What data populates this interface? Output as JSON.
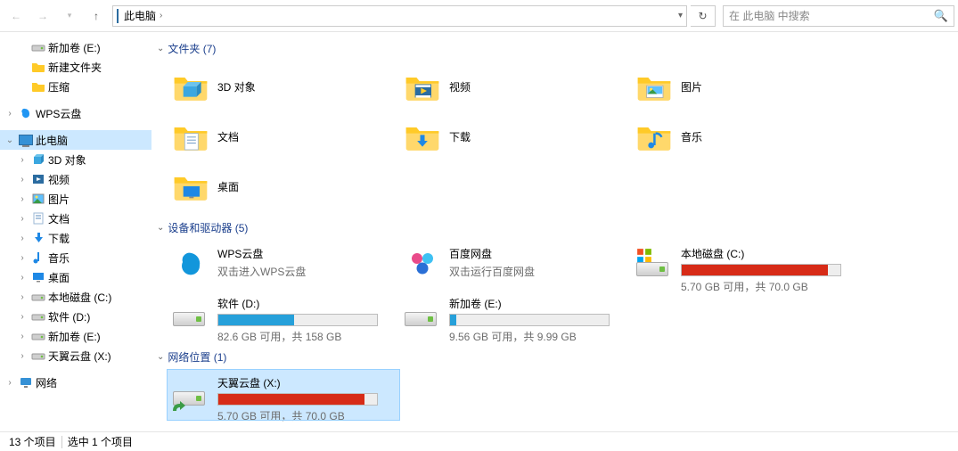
{
  "address": {
    "location": "此电脑",
    "refresh": "↻"
  },
  "search": {
    "placeholder": "在 此电脑 中搜索"
  },
  "nav": {
    "top": [
      {
        "label": "新加卷 (E:)",
        "icon": "drive"
      },
      {
        "label": "新建文件夹",
        "icon": "folder"
      },
      {
        "label": "压缩",
        "icon": "folder"
      }
    ],
    "wps": {
      "label": "WPS云盘"
    },
    "thispc": {
      "label": "此电脑"
    },
    "thispc_children": [
      {
        "label": "3D 对象"
      },
      {
        "label": "视频"
      },
      {
        "label": "图片"
      },
      {
        "label": "文档"
      },
      {
        "label": "下载"
      },
      {
        "label": "音乐"
      },
      {
        "label": "桌面"
      },
      {
        "label": "本地磁盘 (C:)"
      },
      {
        "label": "软件 (D:)"
      },
      {
        "label": "新加卷 (E:)"
      },
      {
        "label": "天翼云盘 (X:)"
      }
    ],
    "network": {
      "label": "网络"
    }
  },
  "sections": {
    "folders": {
      "title": "文件夹 (7)"
    },
    "drives": {
      "title": "设备和驱动器 (5)"
    },
    "netloc": {
      "title": "网络位置 (1)"
    }
  },
  "folders": [
    {
      "label": "3D 对象"
    },
    {
      "label": "视频"
    },
    {
      "label": "图片"
    },
    {
      "label": "文档"
    },
    {
      "label": "下载"
    },
    {
      "label": "音乐"
    },
    {
      "label": "桌面"
    }
  ],
  "drives": [
    {
      "name": "WPS云盘",
      "sub": "双击进入WPS云盘",
      "bar": null,
      "icon": "wps"
    },
    {
      "name": "百度网盘",
      "sub": "双击运行百度网盘",
      "bar": null,
      "icon": "baidu"
    },
    {
      "name": "本地磁盘 (C:)",
      "sub": "5.70 GB 可用，共 70.0 GB",
      "bar": {
        "pct": 92,
        "red": true
      },
      "icon": "hdd-win"
    },
    {
      "name": "软件 (D:)",
      "sub": "82.6 GB 可用，共 158 GB",
      "bar": {
        "pct": 48,
        "red": false
      },
      "icon": "hdd"
    },
    {
      "name": "新加卷 (E:)",
      "sub": "9.56 GB 可用，共 9.99 GB",
      "bar": {
        "pct": 4,
        "red": false
      },
      "icon": "hdd"
    }
  ],
  "netloc": [
    {
      "name": "天翼云盘 (X:)",
      "sub": "5.70 GB 可用，共 70.0 GB",
      "bar": {
        "pct": 92,
        "red": true
      },
      "icon": "netdrive",
      "selected": true
    }
  ],
  "status": {
    "items": "13 个项目",
    "sel": "选中 1 个项目"
  }
}
